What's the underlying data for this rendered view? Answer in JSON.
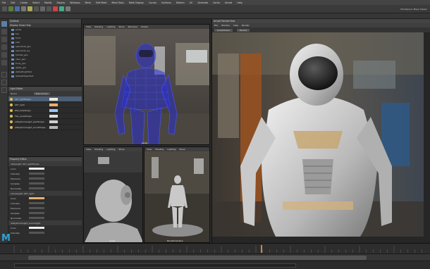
{
  "menubar": {
    "items": [
      "File",
      "Edit",
      "Create",
      "Select",
      "Modify",
      "Display",
      "Windows",
      "Mesh",
      "Edit Mesh",
      "Mesh Tools",
      "Mesh Display",
      "Curves",
      "Surfaces",
      "Deform",
      "UV",
      "Generate",
      "Cache",
      "Arnold",
      "Help"
    ],
    "workspace": "Workspace: Maya Classic"
  },
  "outliner": {
    "title": "Outliner",
    "menu": "Display  Show  Help",
    "items": [
      "persp",
      "top",
      "front",
      "side",
      "spaceSuit_geo",
      "spaceSuit_rig",
      "helmet_geo",
      "visor_geo",
      "body_geo",
      "lights_grp",
      "defaultLightSet",
      "defaultObjectSet"
    ]
  },
  "light_editor": {
    "title": "Light Editor",
    "header": "Name",
    "new_group": "New Group",
    "rows": [
      "SKY_lightShape",
      "KEY_light",
      "RIM_sideShape",
      "FILL_areaShape",
      "aiSkyDomeLight_spotShape",
      "aiSkyDomeLight_scoutShape"
    ]
  },
  "prop_editor": {
    "title": "Property Editor",
    "sections": [
      "aiSkyLight: SKY_lightShape",
      "aiAreaLight: KEY_light",
      "aiSkyDomeLight_sceneLight"
    ],
    "fields": [
      "Color",
      "Intensity",
      "Exposure",
      "Samples",
      "Normalize"
    ]
  },
  "viewports": {
    "top": {
      "menu": [
        "View",
        "Shading",
        "Lighting",
        "Show",
        "Renderer",
        "Panels"
      ],
      "label": "persp"
    },
    "bottom_left": {
      "menu": [
        "View",
        "Shading",
        "Lighting",
        "Show"
      ],
      "label": "persp"
    },
    "bottom_right": {
      "menu": [
        "View",
        "Shading",
        "Lighting",
        "Show"
      ],
      "label": "RenderCamera"
    }
  },
  "render_view": {
    "title": "Arnold RenderView",
    "menu": [
      "File",
      "Window",
      "View",
      "Render"
    ],
    "camera": "perspShape",
    "aov": "Beauty"
  },
  "colors": {
    "accent": "#2fa3d6",
    "selection": "#4d5f77",
    "wire": "#2a2fd0"
  }
}
